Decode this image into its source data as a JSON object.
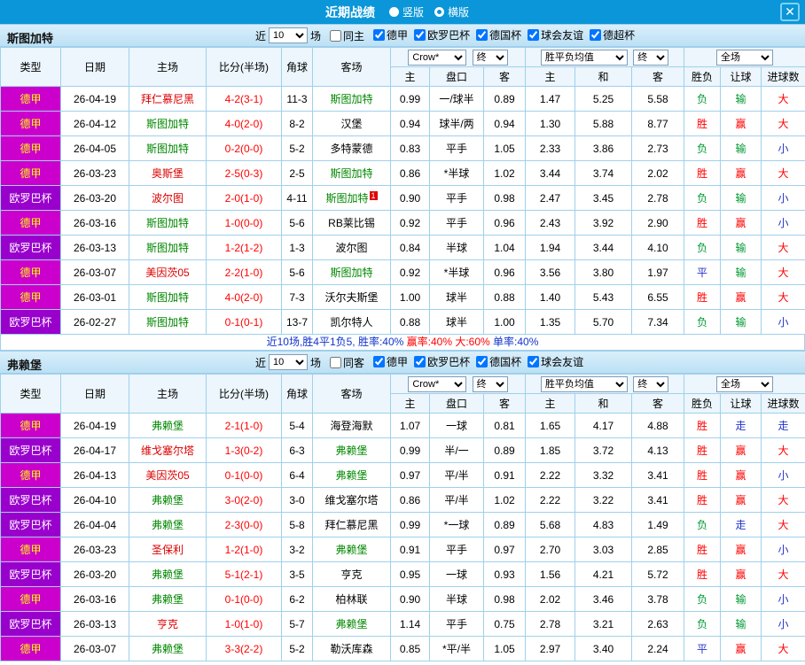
{
  "colors": {
    "topbar_bg": "#0a96d8",
    "grid_border": "#a0d0ec",
    "score": "#ff0000",
    "team_focal": "#008800",
    "team_home_opp": "#dd0000",
    "team_normal": "#000000",
    "res_red": "#ff0000",
    "res_green": "#009933",
    "res_blue": "#2233cc",
    "summary_blue": "#1133cc",
    "summary_red": "#ff0000"
  },
  "league_colors": {
    "德甲": {
      "bg": "#cc00cc",
      "fg": "#ffff00"
    },
    "欧罗巴杯": {
      "bg": "#9900cc",
      "fg": "#ffffff"
    }
  },
  "topbar": {
    "title": "近期战绩",
    "options": [
      {
        "label": "竖版",
        "selected": false
      },
      {
        "label": "横版",
        "selected": true
      }
    ],
    "close_glyph": "✕"
  },
  "table_header": {
    "type": "类型",
    "date": "日期",
    "home": "主场",
    "score": "比分(半场)",
    "corner": "角球",
    "away": "客场",
    "odds_company": "Crow*",
    "final": "终",
    "avg": "胜平负均值",
    "period": "全场",
    "h": "主",
    "hcap": "盘口",
    "a": "客",
    "h2": "主",
    "d2": "和",
    "a2": "客",
    "wl": "胜负",
    "rq": "让球",
    "jq": "进球数"
  },
  "sections": [
    {
      "team": "斯图加特",
      "filter": {
        "near": "近",
        "count": "10",
        "games": "场",
        "same": {
          "label": "同主",
          "checked": false
        },
        "leagues": [
          {
            "label": "德甲",
            "checked": true
          },
          {
            "label": "欧罗巴杯",
            "checked": true
          },
          {
            "label": "德国杯",
            "checked": true
          },
          {
            "label": "球会友谊",
            "checked": true
          },
          {
            "label": "德超杯",
            "checked": true
          }
        ]
      },
      "rows": [
        {
          "league": "德甲",
          "date": "26-04-19",
          "home": {
            "name": "拜仁慕尼黑",
            "role": "opp"
          },
          "score": "4-2(3-1)",
          "corner": "11-3",
          "away": {
            "name": "斯图加特",
            "role": "focal"
          },
          "odds": [
            "0.99",
            "一/球半",
            "0.89"
          ],
          "avg": [
            "1.47",
            "5.25",
            "5.58"
          ],
          "results": [
            {
              "t": "负",
              "c": "green"
            },
            {
              "t": "输",
              "c": "green"
            },
            {
              "t": "大",
              "c": "red"
            }
          ]
        },
        {
          "league": "德甲",
          "date": "26-04-12",
          "home": {
            "name": "斯图加特",
            "role": "focal"
          },
          "score": "4-0(2-0)",
          "corner": "8-2",
          "away": {
            "name": "汉堡",
            "role": "normal"
          },
          "odds": [
            "0.94",
            "球半/两",
            "0.94"
          ],
          "avg": [
            "1.30",
            "5.88",
            "8.77"
          ],
          "results": [
            {
              "t": "胜",
              "c": "red"
            },
            {
              "t": "赢",
              "c": "red"
            },
            {
              "t": "大",
              "c": "red"
            }
          ]
        },
        {
          "league": "德甲",
          "date": "26-04-05",
          "home": {
            "name": "斯图加特",
            "role": "focal"
          },
          "score": "0-2(0-0)",
          "corner": "5-2",
          "away": {
            "name": "多特蒙德",
            "role": "normal"
          },
          "odds": [
            "0.83",
            "平手",
            "1.05"
          ],
          "avg": [
            "2.33",
            "3.86",
            "2.73"
          ],
          "results": [
            {
              "t": "负",
              "c": "green"
            },
            {
              "t": "输",
              "c": "green"
            },
            {
              "t": "小",
              "c": "blue"
            }
          ]
        },
        {
          "league": "德甲",
          "date": "26-03-23",
          "home": {
            "name": "奥斯堡",
            "role": "opp"
          },
          "score": "2-5(0-3)",
          "corner": "2-5",
          "away": {
            "name": "斯图加特",
            "role": "focal"
          },
          "odds": [
            "0.86",
            "*半球",
            "1.02"
          ],
          "avg": [
            "3.44",
            "3.74",
            "2.02"
          ],
          "results": [
            {
              "t": "胜",
              "c": "red"
            },
            {
              "t": "赢",
              "c": "red"
            },
            {
              "t": "大",
              "c": "red"
            }
          ]
        },
        {
          "league": "欧罗巴杯",
          "date": "26-03-20",
          "home": {
            "name": "波尔图",
            "role": "opp"
          },
          "score": "2-0(1-0)",
          "corner": "4-11",
          "away": {
            "name": "斯图加特",
            "role": "focal",
            "mark": "1"
          },
          "odds": [
            "0.90",
            "平手",
            "0.98"
          ],
          "avg": [
            "2.47",
            "3.45",
            "2.78"
          ],
          "results": [
            {
              "t": "负",
              "c": "green"
            },
            {
              "t": "输",
              "c": "green"
            },
            {
              "t": "小",
              "c": "blue"
            }
          ]
        },
        {
          "league": "德甲",
          "date": "26-03-16",
          "home": {
            "name": "斯图加特",
            "role": "focal"
          },
          "score": "1-0(0-0)",
          "corner": "5-6",
          "away": {
            "name": "RB莱比锡",
            "role": "normal"
          },
          "odds": [
            "0.92",
            "平手",
            "0.96"
          ],
          "avg": [
            "2.43",
            "3.92",
            "2.90"
          ],
          "results": [
            {
              "t": "胜",
              "c": "red"
            },
            {
              "t": "赢",
              "c": "red"
            },
            {
              "t": "小",
              "c": "blue"
            }
          ]
        },
        {
          "league": "欧罗巴杯",
          "date": "26-03-13",
          "home": {
            "name": "斯图加特",
            "role": "focal"
          },
          "score": "1-2(1-2)",
          "corner": "1-3",
          "away": {
            "name": "波尔图",
            "role": "normal"
          },
          "odds": [
            "0.84",
            "半球",
            "1.04"
          ],
          "avg": [
            "1.94",
            "3.44",
            "4.10"
          ],
          "results": [
            {
              "t": "负",
              "c": "green"
            },
            {
              "t": "输",
              "c": "green"
            },
            {
              "t": "大",
              "c": "red"
            }
          ]
        },
        {
          "league": "德甲",
          "date": "26-03-07",
          "home": {
            "name": "美因茨05",
            "role": "opp"
          },
          "score": "2-2(1-0)",
          "corner": "5-6",
          "away": {
            "name": "斯图加特",
            "role": "focal"
          },
          "odds": [
            "0.92",
            "*半球",
            "0.96"
          ],
          "avg": [
            "3.56",
            "3.80",
            "1.97"
          ],
          "results": [
            {
              "t": "平",
              "c": "blue"
            },
            {
              "t": "输",
              "c": "green"
            },
            {
              "t": "大",
              "c": "red"
            }
          ]
        },
        {
          "league": "德甲",
          "date": "26-03-01",
          "home": {
            "name": "斯图加特",
            "role": "focal"
          },
          "score": "4-0(2-0)",
          "corner": "7-3",
          "away": {
            "name": "沃尔夫斯堡",
            "role": "normal"
          },
          "odds": [
            "1.00",
            "球半",
            "0.88"
          ],
          "avg": [
            "1.40",
            "5.43",
            "6.55"
          ],
          "results": [
            {
              "t": "胜",
              "c": "red"
            },
            {
              "t": "赢",
              "c": "red"
            },
            {
              "t": "大",
              "c": "red"
            }
          ]
        },
        {
          "league": "欧罗巴杯",
          "date": "26-02-27",
          "home": {
            "name": "斯图加特",
            "role": "focal"
          },
          "score": "0-1(0-1)",
          "corner": "13-7",
          "away": {
            "name": "凯尔特人",
            "role": "normal"
          },
          "odds": [
            "0.88",
            "球半",
            "1.00"
          ],
          "avg": [
            "1.35",
            "5.70",
            "7.34"
          ],
          "results": [
            {
              "t": "负",
              "c": "green"
            },
            {
              "t": "输",
              "c": "green"
            },
            {
              "t": "小",
              "c": "blue"
            }
          ]
        }
      ],
      "summary": [
        {
          "text": "近10场,胜4平1负5, ",
          "color": "blue"
        },
        {
          "text": "胜率:40% ",
          "color": "blue"
        },
        {
          "text": "赢率:40% ",
          "color": "red"
        },
        {
          "text": "大:60% ",
          "color": "red"
        },
        {
          "text": "单率:40%",
          "color": "blue"
        }
      ]
    },
    {
      "team": "弗赖堡",
      "filter": {
        "near": "近",
        "count": "10",
        "games": "场",
        "same": {
          "label": "同客",
          "checked": false
        },
        "leagues": [
          {
            "label": "德甲",
            "checked": true
          },
          {
            "label": "欧罗巴杯",
            "checked": true
          },
          {
            "label": "德国杯",
            "checked": true
          },
          {
            "label": "球会友谊",
            "checked": true
          }
        ]
      },
      "rows": [
        {
          "league": "德甲",
          "date": "26-04-19",
          "home": {
            "name": "弗赖堡",
            "role": "focal"
          },
          "score": "2-1(1-0)",
          "corner": "5-4",
          "away": {
            "name": "海登海默",
            "role": "normal"
          },
          "odds": [
            "1.07",
            "一球",
            "0.81"
          ],
          "avg": [
            "1.65",
            "4.17",
            "4.88"
          ],
          "results": [
            {
              "t": "胜",
              "c": "red"
            },
            {
              "t": "走",
              "c": "blue"
            },
            {
              "t": "走",
              "c": "blue"
            }
          ]
        },
        {
          "league": "欧罗巴杯",
          "date": "26-04-17",
          "home": {
            "name": "维戈塞尔塔",
            "role": "opp"
          },
          "score": "1-3(0-2)",
          "corner": "6-3",
          "away": {
            "name": "弗赖堡",
            "role": "focal"
          },
          "odds": [
            "0.99",
            "半/一",
            "0.89"
          ],
          "avg": [
            "1.85",
            "3.72",
            "4.13"
          ],
          "results": [
            {
              "t": "胜",
              "c": "red"
            },
            {
              "t": "赢",
              "c": "red"
            },
            {
              "t": "大",
              "c": "red"
            }
          ]
        },
        {
          "league": "德甲",
          "date": "26-04-13",
          "home": {
            "name": "美因茨05",
            "role": "opp"
          },
          "score": "0-1(0-0)",
          "corner": "6-4",
          "away": {
            "name": "弗赖堡",
            "role": "focal"
          },
          "odds": [
            "0.97",
            "平/半",
            "0.91"
          ],
          "avg": [
            "2.22",
            "3.32",
            "3.41"
          ],
          "results": [
            {
              "t": "胜",
              "c": "red"
            },
            {
              "t": "赢",
              "c": "red"
            },
            {
              "t": "小",
              "c": "blue"
            }
          ]
        },
        {
          "league": "欧罗巴杯",
          "date": "26-04-10",
          "home": {
            "name": "弗赖堡",
            "role": "focal"
          },
          "score": "3-0(2-0)",
          "corner": "3-0",
          "away": {
            "name": "维戈塞尔塔",
            "role": "normal"
          },
          "odds": [
            "0.86",
            "平/半",
            "1.02"
          ],
          "avg": [
            "2.22",
            "3.22",
            "3.41"
          ],
          "results": [
            {
              "t": "胜",
              "c": "red"
            },
            {
              "t": "赢",
              "c": "red"
            },
            {
              "t": "大",
              "c": "red"
            }
          ]
        },
        {
          "league": "欧罗巴杯",
          "date": "26-04-04",
          "home": {
            "name": "弗赖堡",
            "role": "focal"
          },
          "score": "2-3(0-0)",
          "corner": "5-8",
          "away": {
            "name": "拜仁慕尼黑",
            "role": "normal"
          },
          "odds": [
            "0.99",
            "*一球",
            "0.89"
          ],
          "avg": [
            "5.68",
            "4.83",
            "1.49"
          ],
          "results": [
            {
              "t": "负",
              "c": "green"
            },
            {
              "t": "走",
              "c": "blue"
            },
            {
              "t": "大",
              "c": "red"
            }
          ]
        },
        {
          "league": "德甲",
          "date": "26-03-23",
          "home": {
            "name": "圣保利",
            "role": "opp"
          },
          "score": "1-2(1-0)",
          "corner": "3-2",
          "away": {
            "name": "弗赖堡",
            "role": "focal"
          },
          "odds": [
            "0.91",
            "平手",
            "0.97"
          ],
          "avg": [
            "2.70",
            "3.03",
            "2.85"
          ],
          "results": [
            {
              "t": "胜",
              "c": "red"
            },
            {
              "t": "赢",
              "c": "red"
            },
            {
              "t": "小",
              "c": "blue"
            }
          ]
        },
        {
          "league": "欧罗巴杯",
          "date": "26-03-20",
          "home": {
            "name": "弗赖堡",
            "role": "focal"
          },
          "score": "5-1(2-1)",
          "corner": "3-5",
          "away": {
            "name": "亨克",
            "role": "normal"
          },
          "odds": [
            "0.95",
            "一球",
            "0.93"
          ],
          "avg": [
            "1.56",
            "4.21",
            "5.72"
          ],
          "results": [
            {
              "t": "胜",
              "c": "red"
            },
            {
              "t": "赢",
              "c": "red"
            },
            {
              "t": "大",
              "c": "red"
            }
          ]
        },
        {
          "league": "德甲",
          "date": "26-03-16",
          "home": {
            "name": "弗赖堡",
            "role": "focal"
          },
          "score": "0-1(0-0)",
          "corner": "6-2",
          "away": {
            "name": "柏林联",
            "role": "normal"
          },
          "odds": [
            "0.90",
            "半球",
            "0.98"
          ],
          "avg": [
            "2.02",
            "3.46",
            "3.78"
          ],
          "results": [
            {
              "t": "负",
              "c": "green"
            },
            {
              "t": "输",
              "c": "green"
            },
            {
              "t": "小",
              "c": "blue"
            }
          ]
        },
        {
          "league": "欧罗巴杯",
          "date": "26-03-13",
          "home": {
            "name": "亨克",
            "role": "opp"
          },
          "score": "1-0(1-0)",
          "corner": "5-7",
          "away": {
            "name": "弗赖堡",
            "role": "focal"
          },
          "odds": [
            "1.14",
            "平手",
            "0.75"
          ],
          "avg": [
            "2.78",
            "3.21",
            "2.63"
          ],
          "results": [
            {
              "t": "负",
              "c": "green"
            },
            {
              "t": "输",
              "c": "green"
            },
            {
              "t": "小",
              "c": "blue"
            }
          ]
        },
        {
          "league": "德甲",
          "date": "26-03-07",
          "home": {
            "name": "弗赖堡",
            "role": "focal"
          },
          "score": "3-3(2-2)",
          "corner": "5-2",
          "away": {
            "name": "勒沃库森",
            "role": "normal"
          },
          "odds": [
            "0.85",
            "*平/半",
            "1.05"
          ],
          "avg": [
            "2.97",
            "3.40",
            "2.24"
          ],
          "results": [
            {
              "t": "平",
              "c": "blue"
            },
            {
              "t": "赢",
              "c": "red"
            },
            {
              "t": "大",
              "c": "red"
            }
          ]
        }
      ],
      "summary": []
    }
  ]
}
